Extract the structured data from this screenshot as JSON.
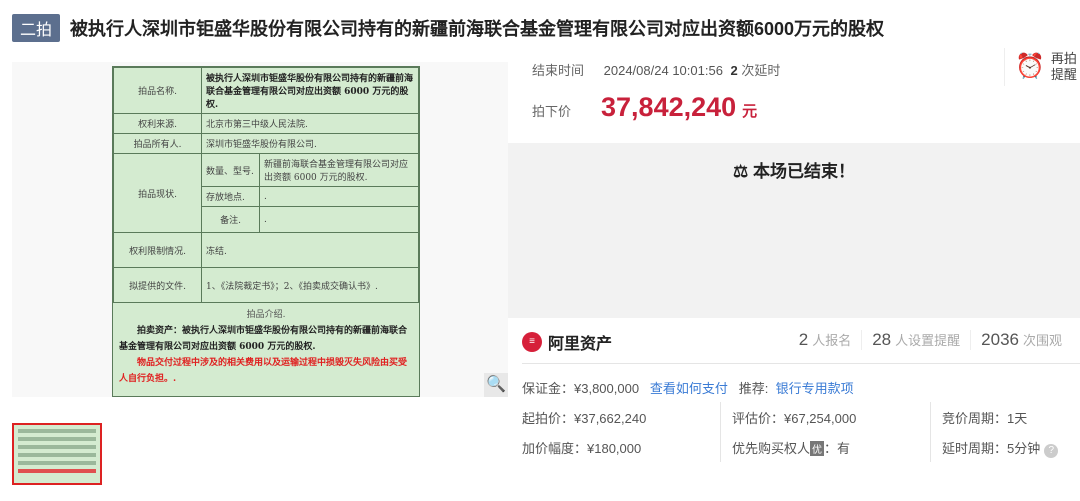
{
  "header": {
    "round": "二拍",
    "title": "被执行人深圳市钜盛华股份有限公司持有的新疆前海联合基金管理有限公司对应出资额6000万元的股权"
  },
  "document": {
    "rows": [
      {
        "label": "拍品名称.",
        "value": "被执行人深圳市钜盛华股份有限公司持有的新疆前海联合基金管理有限公司对应出资额 6000 万元的股权."
      },
      {
        "label": "权利来源.",
        "value": "北京市第三中级人民法院."
      },
      {
        "label": "拍品所有人.",
        "value": "深圳市钜盛华股份有限公司."
      },
      {
        "label": "拍品现状.",
        "sub": [
          {
            "label": "数量、型号.",
            "value": "新疆前海联合基金管理有限公司对应出资额 6000 万元的股权."
          },
          {
            "label": "存放地点.",
            "value": "."
          },
          {
            "label": "备注.",
            "value": "."
          }
        ]
      },
      {
        "label": "权利限制情况.",
        "value": "冻结."
      },
      {
        "label": "拟提供的文件.",
        "value": "1、《法院裁定书》；2、《拍卖成交确认书》."
      }
    ],
    "intro_title": "拍品介绍.",
    "intro_text": "拍卖资产：被执行人深圳市钜盛华股份有限公司持有的新疆前海联合基金管理有限公司对应出资额 6000 万元的股权.",
    "warning": "物品交付过程中涉及的相关费用以及运输过程中损毁灭失风险由买受人自行负担。."
  },
  "auction": {
    "end_label": "结束时间",
    "end_time": "2024/08/24 10:01:56",
    "delays": "2",
    "delay_label": "次延时",
    "remind": "再拍\n提醒",
    "remind_line1": "再拍",
    "remind_line2": "提醒",
    "price_label": "拍下价",
    "price": "37,842,240",
    "unit": "元",
    "ended_msg": "本场已结束！"
  },
  "brand": "阿里资产",
  "stats": [
    {
      "n": "2",
      "l": "人报名"
    },
    {
      "n": "28",
      "l": "人设置提醒"
    },
    {
      "n": "2036",
      "l": "次围观"
    }
  ],
  "details": {
    "deposit": "保证金：¥3,800,000",
    "how_pay": "查看如何支付",
    "recommend": "推荐:",
    "bank": "银行专用款项",
    "start": "起拍价：¥37,662,240",
    "eval": "评估价：¥67,254,000",
    "period": "竞价周期：1天",
    "incr": "加价幅度：¥180,000",
    "priority": "优先购买权人",
    "you": "优",
    "priority_val": "：有",
    "delay": "延时周期：5分钟"
  },
  "colors": {
    "accent": "#c8213b",
    "link": "#3a7bd5"
  }
}
